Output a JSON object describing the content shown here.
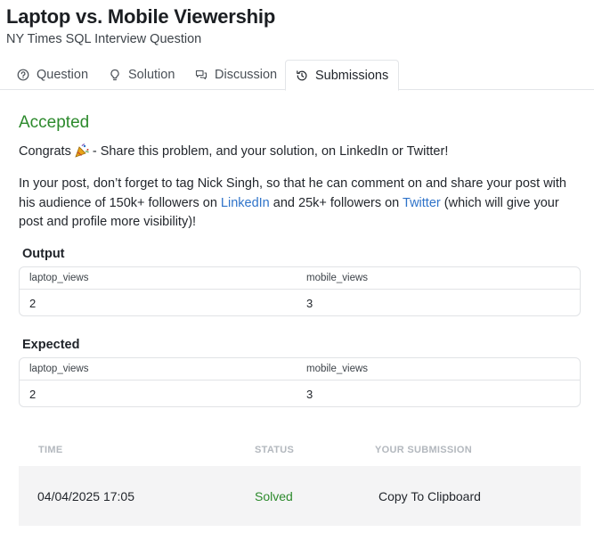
{
  "problem": {
    "title": "Laptop vs. Mobile Viewership",
    "subtitle": "NY Times SQL Interview Question"
  },
  "tabs": [
    {
      "label": "Question",
      "icon": "question-circle-icon"
    },
    {
      "label": "Solution",
      "icon": "lightbulb-icon"
    },
    {
      "label": "Discussion",
      "icon": "chat-bubbles-icon"
    },
    {
      "label": "Submissions",
      "icon": "history-icon",
      "active": true
    }
  ],
  "result": {
    "status": "Accepted",
    "congrats_prefix": "Congrats",
    "congrats_suffix": "- Share this problem, and your solution, on LinkedIn or Twitter!",
    "share_p1": "In your post, don’t forget to tag Nick Singh, so that he can comment on and share your post with his audience of 150k+ followers on",
    "linkedin": "LinkedIn",
    "share_p2": "and 25k+ followers on",
    "twitter": "Twitter",
    "share_p3": "(which will give your post and profile more visibility)!"
  },
  "output": {
    "label": "Output",
    "columns": [
      "laptop_views",
      "mobile_views"
    ],
    "rows": [
      [
        "2",
        "3"
      ]
    ]
  },
  "expected": {
    "label": "Expected",
    "columns": [
      "laptop_views",
      "mobile_views"
    ],
    "rows": [
      [
        "2",
        "3"
      ]
    ]
  },
  "submissions": {
    "headers": {
      "time": "TIME",
      "status": "STATUS",
      "submission": "YOUR SUBMISSION"
    },
    "rows": [
      {
        "time": "04/04/2025 17:05",
        "status": "Solved",
        "action": "Copy To Clipboard"
      }
    ]
  },
  "colors": {
    "accepted": "#2d8a2d",
    "link": "#2f73c9",
    "row_bg": "#f4f4f5"
  }
}
